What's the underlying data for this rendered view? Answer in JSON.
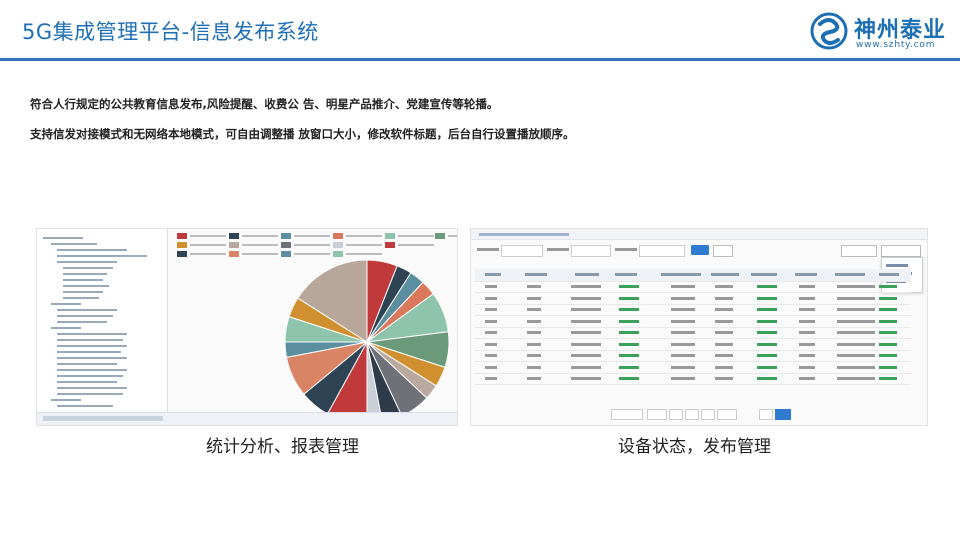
{
  "slide": {
    "title": "5G集成管理平台-信息发布系统",
    "logo_text": "神州泰业",
    "logo_url": "www.szhty.com",
    "description_1": "符合人行规定的公共教育信息发布,风险提醒、收费公 告、明星产品推介、党建宣传等轮播。",
    "description_2": "支持信发对接模式和无网络本地模式，可自由调整播 放窗口大小，修改软件标题，后台自行设置播放顺序。",
    "caption_left": "统计分析、报表管理",
    "caption_right": "设备状态，发布管理"
  },
  "colors": {
    "accent": "#2f73b8",
    "title": "#1f6fb5",
    "button": "#2f7bd0"
  },
  "chart_data": {
    "type": "pie",
    "values": [
      6,
      3,
      3,
      3,
      8,
      7,
      4,
      3,
      6,
      4,
      3,
      8,
      6,
      8,
      3,
      5,
      4,
      16
    ],
    "colors": [
      "#c0393b",
      "#2e4353",
      "#5b8fa0",
      "#d9785a",
      "#8ec4ab",
      "#6b9a7a",
      "#d1902f",
      "#b8a89e",
      "#6e7178",
      "#2e3b4b",
      "#c9cfd6",
      "#c0393b",
      "#2e4353",
      "#d98465",
      "#5b8fa0",
      "#8ec4ab",
      "#d1902f",
      "#b8a69a"
    ]
  }
}
